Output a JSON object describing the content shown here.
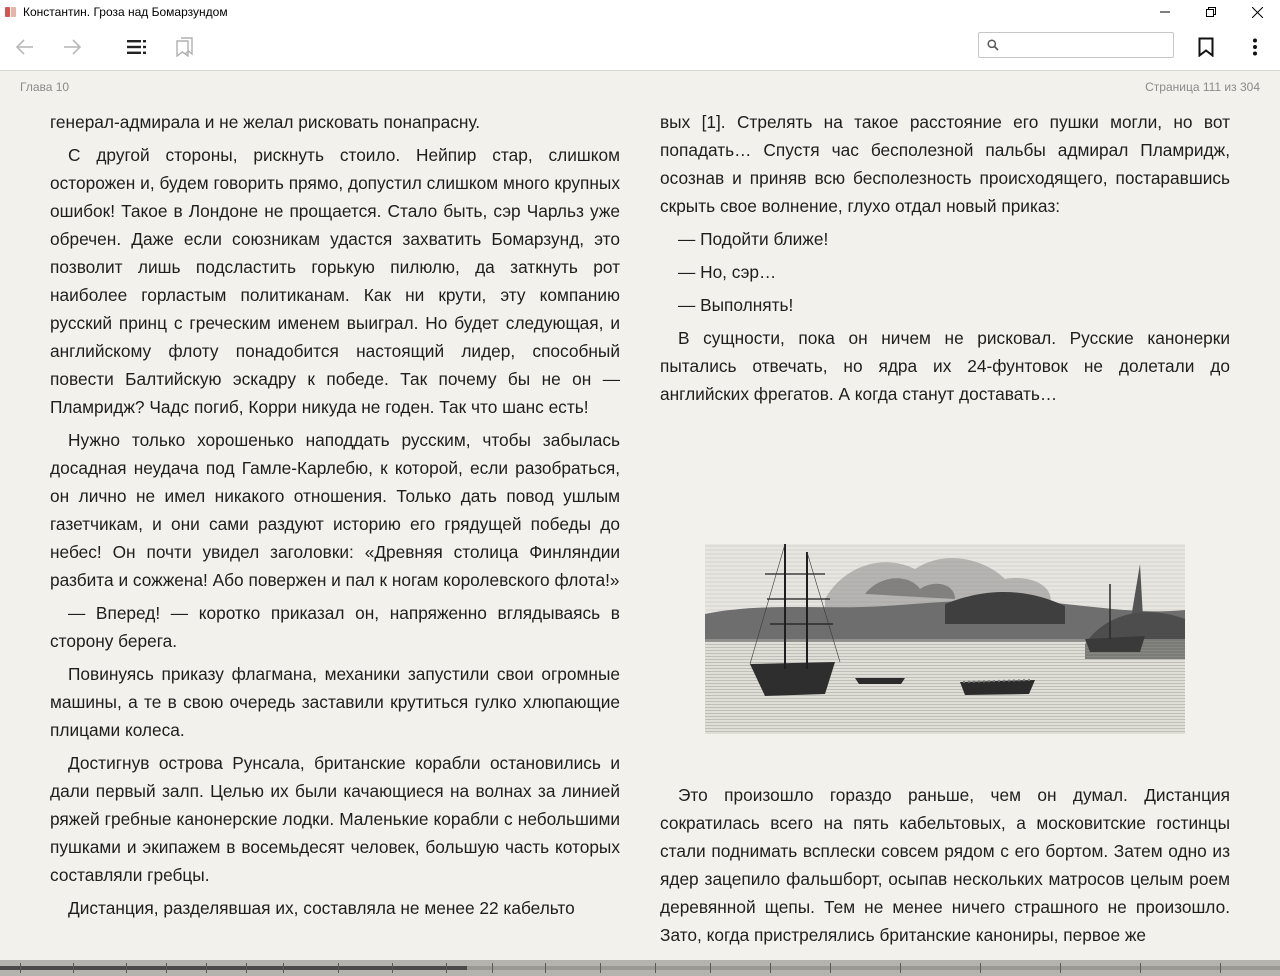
{
  "window": {
    "title": "Константин. Гроза над Бомарзундом"
  },
  "toolbar": {
    "back_icon": "arrow-left-icon",
    "forward_icon": "arrow-right-icon",
    "toc_icon": "contents-list-icon",
    "bookmarks_icon": "bookmarks-icon",
    "search_placeholder": "",
    "search_value": "",
    "bookmark_icon": "bookmark-add-icon",
    "menu_icon": "more-vertical-icon"
  },
  "header": {
    "chapter": "Глава 10",
    "page_info": "Страница 111 из 304"
  },
  "reading_progress": {
    "current_page": 111,
    "total_pages": 304
  },
  "left_column": {
    "paragraphs": [
      "генерал-адмирала и не желал рисковать понапрасну.",
      "С другой стороны, рискнуть стоило. Нейпир стар, слишком осто­рожен и, будем говорить прямо, допустил слишком много крупных ошибок! Такое в Лондоне не прощается. Стало быть, сэр Чарльз уже обречен. Даже если союзникам удастся захватить Бомарзунд, это позволит лишь подсластить горькую пилюлю, да заткнуть рот наиболее горластым политиканам. Как ни крути, эту компанию рус­ский принц с греческим именем выиграл. Но будет следующая, и английскому флоту понадобится настоящий лидер, способный по­вести Балтийскую эскадру к победе. Так почему бы не он — Пламридж? Чадс погиб, Корри никуда не годен. Так что шанс есть!",
      "Нужно только хорошенько наподдать русским, чтобы забылась досадная неудача под Гамле-Карлебю, к которой, если разобрать­ся, он лично не имел никакого отношения. Только дать повод уш­лым газетчикам, и они сами раздуют историю его грядущей победы до небес! Он почти увидел заголовки: «Древняя столица Финлян­дии разбита и сожжена! Або повержен и пал к ногам королевского флота!»",
      "— Вперед! — коротко приказал он, напряженно вглядываясь в сторону берега.",
      "Повинуясь приказу флагмана, механики запустили свои огром­ные машины, а те в свою очередь заставили крутиться гулко хлю­пающие плицами колеса.",
      "Достигнув острова Рунсала, британские корабли остановились и дали первый залп. Целью их были качающиеся на волнах за лини­ей ряжей гребные канонерские лодки. Маленькие корабли с не­большими пушками и экипажем в восемьдесят человек, большую часть которых составляли гребцы.",
      "Дистанция, разделявшая их, составляла не менее 22 кабельто­"
    ]
  },
  "right_column": {
    "paragraphs_top": [
      "вых [1]. Стрелять на такое расстояние его пушки могли, но вот по­падать… Спустя час бесполезной пальбы адмирал Пламридж, осо­знав и приняв всю бесполезность происходящего, постаравшись скрыть свое волнение, глухо отдал новый приказ:",
      "— Подойти ближе!",
      "— Но, сэр…",
      "— Выполнять!",
      "В сущности, пока он ничем не рисковал. Русские канонерки пы­тались отвечать, но ядра их 24-фунтовок не долетали до англий­ских фрегатов. А когда станут доставать…"
    ],
    "paragraphs_bottom": [
      "Это произошло гораздо раньше, чем он думал. Дистанция сокра­тилась всего на пять кабельтовых, а московитские гостинцы стали поднимать всплески совсем рядом с его бортом. Затем одно из ядер зацепило фальшборт, осыпав нескольких матросов целым ро­ем деревянной щепы. Тем не менее ничего страшного не произо­шло. Зато, когда пристрелялись британские канониры, первое же"
    ],
    "illustration_icon": "engraving-warships-illustration"
  }
}
